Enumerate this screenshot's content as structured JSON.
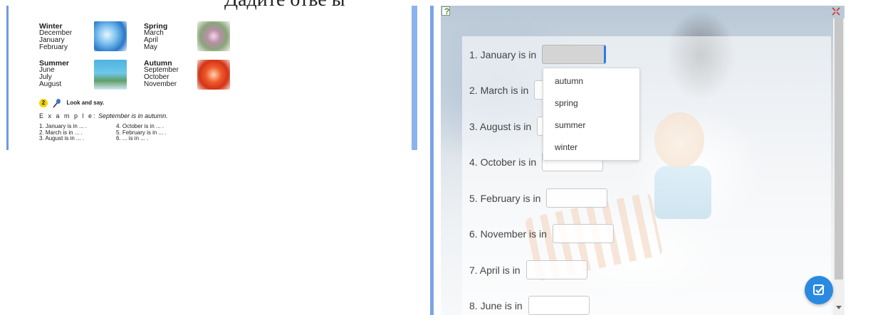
{
  "caption": "Дадите отве ы",
  "textbook": {
    "seasons": [
      {
        "name": "Winter",
        "months": [
          "December",
          "January",
          "February"
        ]
      },
      {
        "name": "Spring",
        "months": [
          "March",
          "April",
          "May"
        ]
      },
      {
        "name": "Summer",
        "months": [
          "June",
          "July",
          "August"
        ]
      },
      {
        "name": "Autumn",
        "months": [
          "September",
          "October",
          "November"
        ]
      }
    ],
    "task_number": "2",
    "task_title": "Look and say.",
    "example_label": "E x a m p l e:",
    "example_text": "September is in autumn.",
    "questions_left": [
      "1. January is in ... .",
      "2. March is in ... .",
      "3. August is in ... ."
    ],
    "questions_right": [
      "4. October is in ... .",
      "5. February is in ... .",
      "6. ... is in ... ."
    ]
  },
  "exercise": {
    "questions": [
      {
        "label": "1. January is in",
        "value": ""
      },
      {
        "label": "2. March is in",
        "value": ""
      },
      {
        "label": "3. August is in",
        "value": ""
      },
      {
        "label": "4. October is in",
        "value": ""
      },
      {
        "label": "5. February is in",
        "value": ""
      },
      {
        "label": "6. November is in",
        "value": ""
      },
      {
        "label": "7. April is in",
        "value": ""
      },
      {
        "label": "8. June is in",
        "value": ""
      }
    ],
    "dropdown_options": [
      "autumn",
      "spring",
      "summer",
      "winter"
    ],
    "icons": {
      "help": "help-icon",
      "close": "close-icon",
      "check": "check-icon"
    },
    "colors": {
      "accent": "#2a8ae0",
      "frame_border": "#7aa5e6"
    }
  }
}
